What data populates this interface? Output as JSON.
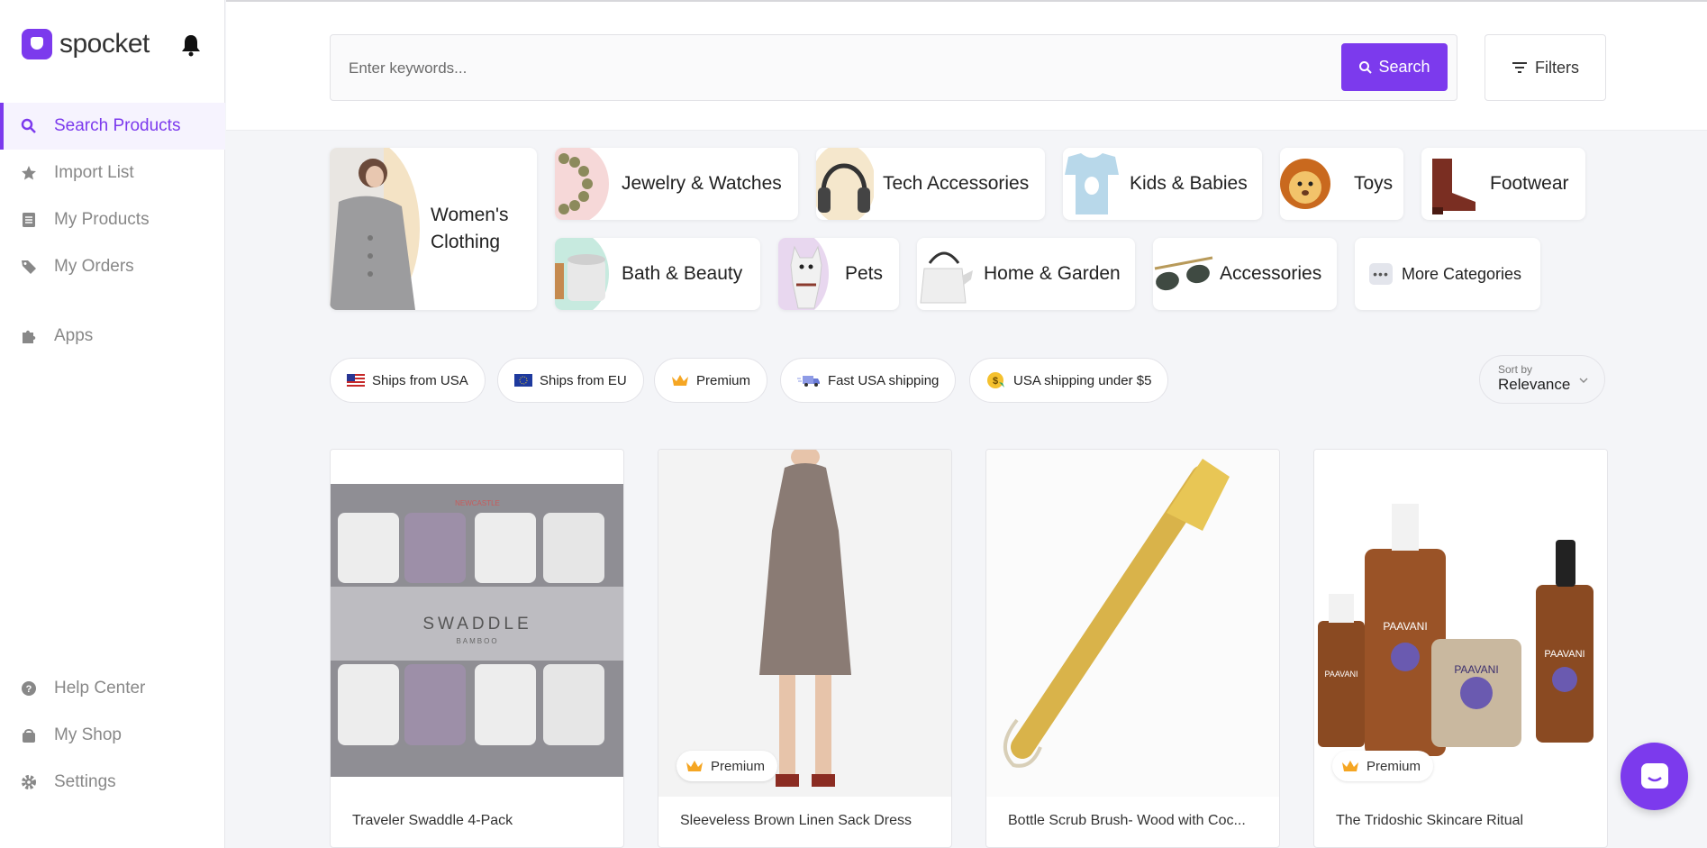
{
  "app": {
    "brand": "spocket"
  },
  "sidebar": {
    "items": [
      {
        "label": "Search Products",
        "icon": "search-icon",
        "active": true
      },
      {
        "label": "Import List",
        "icon": "star-icon"
      },
      {
        "label": "My Products",
        "icon": "list-icon"
      },
      {
        "label": "My Orders",
        "icon": "tag-icon"
      },
      {
        "label": "Apps",
        "icon": "puzzle-icon"
      }
    ],
    "bottom_items": [
      {
        "label": "Help Center",
        "icon": "help-icon"
      },
      {
        "label": "My Shop",
        "icon": "shop-icon"
      },
      {
        "label": "Settings",
        "icon": "gear-icon"
      }
    ]
  },
  "search": {
    "placeholder": "Enter keywords...",
    "button_label": "Search",
    "filters_label": "Filters"
  },
  "categories": [
    {
      "label": "Women's Clothing"
    },
    {
      "label": "Jewelry & Watches"
    },
    {
      "label": "Tech Accessories"
    },
    {
      "label": "Kids & Babies"
    },
    {
      "label": "Toys"
    },
    {
      "label": "Footwear"
    },
    {
      "label": "Bath & Beauty"
    },
    {
      "label": "Pets"
    },
    {
      "label": "Home & Garden"
    },
    {
      "label": "Accessories"
    },
    {
      "label": "More Categories"
    }
  ],
  "chips": [
    {
      "label": "Ships from USA"
    },
    {
      "label": "Ships from EU"
    },
    {
      "label": "Premium"
    },
    {
      "label": "Fast USA shipping"
    },
    {
      "label": "USA shipping under $5"
    }
  ],
  "sort": {
    "label": "Sort by",
    "value": "Relevance"
  },
  "products": [
    {
      "title": "Traveler Swaddle 4-Pack",
      "premium": false,
      "image_text": "SWADDLE",
      "image_subtext": "BAMBOO",
      "image_brand": "NEWCASTLE"
    },
    {
      "title": "Sleeveless Brown Linen Sack Dress",
      "premium": true
    },
    {
      "title": "Bottle Scrub Brush- Wood with Coc...",
      "premium": false
    },
    {
      "title": "The Tridoshic Skincare Ritual",
      "premium": true,
      "image_brand": "PAAVANI"
    }
  ],
  "badge_label": "Premium",
  "colors": {
    "accent": "#7c3aed"
  }
}
